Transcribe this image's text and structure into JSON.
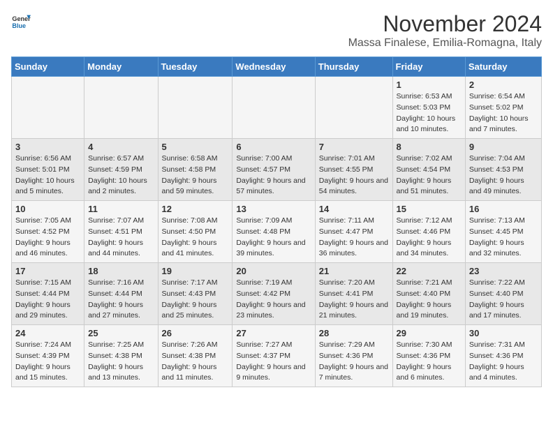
{
  "logo": {
    "text_general": "General",
    "text_blue": "Blue"
  },
  "title": "November 2024",
  "subtitle": "Massa Finalese, Emilia-Romagna, Italy",
  "days_of_week": [
    "Sunday",
    "Monday",
    "Tuesday",
    "Wednesday",
    "Thursday",
    "Friday",
    "Saturday"
  ],
  "weeks": [
    {
      "days": [
        {
          "num": "",
          "info": ""
        },
        {
          "num": "",
          "info": ""
        },
        {
          "num": "",
          "info": ""
        },
        {
          "num": "",
          "info": ""
        },
        {
          "num": "",
          "info": ""
        },
        {
          "num": "1",
          "info": "Sunrise: 6:53 AM\nSunset: 5:03 PM\nDaylight: 10 hours and 10 minutes."
        },
        {
          "num": "2",
          "info": "Sunrise: 6:54 AM\nSunset: 5:02 PM\nDaylight: 10 hours and 7 minutes."
        }
      ]
    },
    {
      "days": [
        {
          "num": "3",
          "info": "Sunrise: 6:56 AM\nSunset: 5:01 PM\nDaylight: 10 hours and 5 minutes."
        },
        {
          "num": "4",
          "info": "Sunrise: 6:57 AM\nSunset: 4:59 PM\nDaylight: 10 hours and 2 minutes."
        },
        {
          "num": "5",
          "info": "Sunrise: 6:58 AM\nSunset: 4:58 PM\nDaylight: 9 hours and 59 minutes."
        },
        {
          "num": "6",
          "info": "Sunrise: 7:00 AM\nSunset: 4:57 PM\nDaylight: 9 hours and 57 minutes."
        },
        {
          "num": "7",
          "info": "Sunrise: 7:01 AM\nSunset: 4:55 PM\nDaylight: 9 hours and 54 minutes."
        },
        {
          "num": "8",
          "info": "Sunrise: 7:02 AM\nSunset: 4:54 PM\nDaylight: 9 hours and 51 minutes."
        },
        {
          "num": "9",
          "info": "Sunrise: 7:04 AM\nSunset: 4:53 PM\nDaylight: 9 hours and 49 minutes."
        }
      ]
    },
    {
      "days": [
        {
          "num": "10",
          "info": "Sunrise: 7:05 AM\nSunset: 4:52 PM\nDaylight: 9 hours and 46 minutes."
        },
        {
          "num": "11",
          "info": "Sunrise: 7:07 AM\nSunset: 4:51 PM\nDaylight: 9 hours and 44 minutes."
        },
        {
          "num": "12",
          "info": "Sunrise: 7:08 AM\nSunset: 4:50 PM\nDaylight: 9 hours and 41 minutes."
        },
        {
          "num": "13",
          "info": "Sunrise: 7:09 AM\nSunset: 4:48 PM\nDaylight: 9 hours and 39 minutes."
        },
        {
          "num": "14",
          "info": "Sunrise: 7:11 AM\nSunset: 4:47 PM\nDaylight: 9 hours and 36 minutes."
        },
        {
          "num": "15",
          "info": "Sunrise: 7:12 AM\nSunset: 4:46 PM\nDaylight: 9 hours and 34 minutes."
        },
        {
          "num": "16",
          "info": "Sunrise: 7:13 AM\nSunset: 4:45 PM\nDaylight: 9 hours and 32 minutes."
        }
      ]
    },
    {
      "days": [
        {
          "num": "17",
          "info": "Sunrise: 7:15 AM\nSunset: 4:44 PM\nDaylight: 9 hours and 29 minutes."
        },
        {
          "num": "18",
          "info": "Sunrise: 7:16 AM\nSunset: 4:44 PM\nDaylight: 9 hours and 27 minutes."
        },
        {
          "num": "19",
          "info": "Sunrise: 7:17 AM\nSunset: 4:43 PM\nDaylight: 9 hours and 25 minutes."
        },
        {
          "num": "20",
          "info": "Sunrise: 7:19 AM\nSunset: 4:42 PM\nDaylight: 9 hours and 23 minutes."
        },
        {
          "num": "21",
          "info": "Sunrise: 7:20 AM\nSunset: 4:41 PM\nDaylight: 9 hours and 21 minutes."
        },
        {
          "num": "22",
          "info": "Sunrise: 7:21 AM\nSunset: 4:40 PM\nDaylight: 9 hours and 19 minutes."
        },
        {
          "num": "23",
          "info": "Sunrise: 7:22 AM\nSunset: 4:40 PM\nDaylight: 9 hours and 17 minutes."
        }
      ]
    },
    {
      "days": [
        {
          "num": "24",
          "info": "Sunrise: 7:24 AM\nSunset: 4:39 PM\nDaylight: 9 hours and 15 minutes."
        },
        {
          "num": "25",
          "info": "Sunrise: 7:25 AM\nSunset: 4:38 PM\nDaylight: 9 hours and 13 minutes."
        },
        {
          "num": "26",
          "info": "Sunrise: 7:26 AM\nSunset: 4:38 PM\nDaylight: 9 hours and 11 minutes."
        },
        {
          "num": "27",
          "info": "Sunrise: 7:27 AM\nSunset: 4:37 PM\nDaylight: 9 hours and 9 minutes."
        },
        {
          "num": "28",
          "info": "Sunrise: 7:29 AM\nSunset: 4:36 PM\nDaylight: 9 hours and 7 minutes."
        },
        {
          "num": "29",
          "info": "Sunrise: 7:30 AM\nSunset: 4:36 PM\nDaylight: 9 hours and 6 minutes."
        },
        {
          "num": "30",
          "info": "Sunrise: 7:31 AM\nSunset: 4:36 PM\nDaylight: 9 hours and 4 minutes."
        }
      ]
    }
  ]
}
